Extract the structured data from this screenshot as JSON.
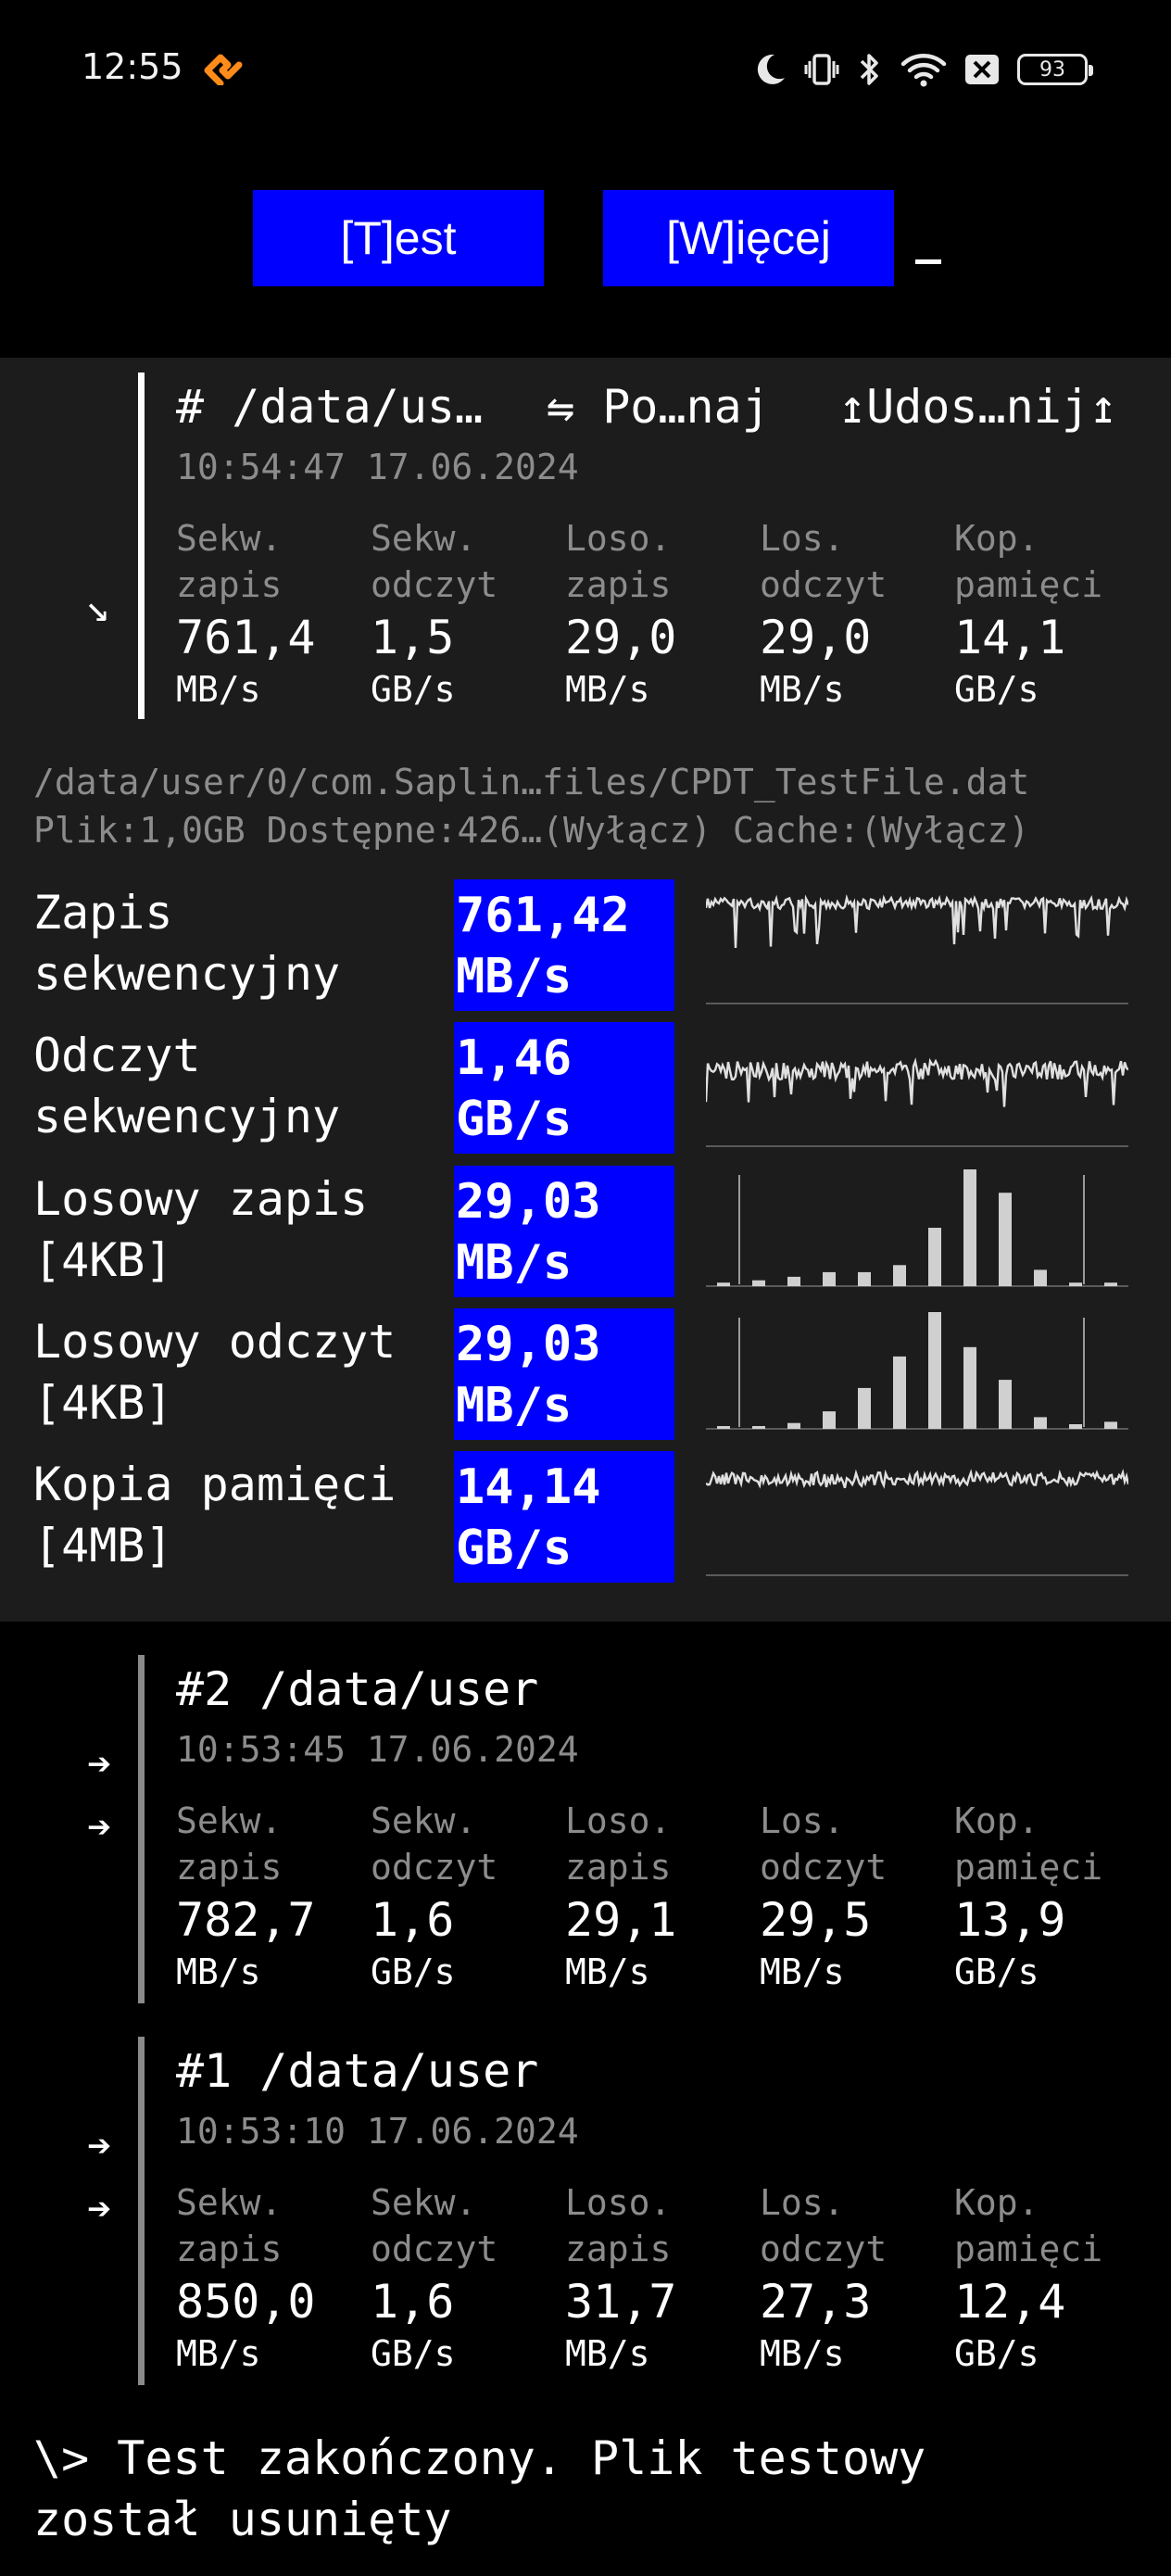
{
  "status_bar": {
    "time": "12:55",
    "battery": "93"
  },
  "toolbar": {
    "test_label": "[T]est",
    "more_label": "[W]ięcej",
    "cursor": "_"
  },
  "current": {
    "title": "#  /data/us…",
    "compare_label": "⇋ Po…naj",
    "share_label": "↥Udos…nij↥",
    "date": "10:54:47 17.06.2024",
    "arrow": "↘",
    "metrics": [
      {
        "label1": "Sekw.",
        "label2": "zapis",
        "value": "761,4",
        "unit": "MB/s"
      },
      {
        "label1": "Sekw.",
        "label2": "odczyt",
        "value": "1,5",
        "unit": "GB/s"
      },
      {
        "label1": "Loso.",
        "label2": "zapis",
        "value": "29,0",
        "unit": "MB/s"
      },
      {
        "label1": "Los.",
        "label2": "odczyt",
        "value": "29,0",
        "unit": "MB/s"
      },
      {
        "label1": "Kop.",
        "label2": "pamięci",
        "value": "14,1",
        "unit": "GB/s"
      }
    ],
    "file_path": "/data/user/0/com.Saplin…files/CPDT_TestFile.dat",
    "file_info": "Plik:1,0GB Dostępne:426…(Wyłącz) Cache:(Wyłącz)",
    "rows": [
      {
        "label1": "Zapis",
        "label2": "sekwencyjny",
        "value1": "761,42",
        "value2": "MB/s",
        "graph": "noise-seq-write"
      },
      {
        "label1": "Odczyt",
        "label2": "sekwencyjny",
        "value1": "1,46",
        "value2": "GB/s",
        "graph": "noise-seq-read"
      },
      {
        "label1": "Losowy zapis",
        "label2": "[4KB]",
        "value1": "29,03",
        "value2": "MB/s",
        "graph": "histogram",
        "bars": [
          0.03,
          0.05,
          0.08,
          0.12,
          0.12,
          0.18,
          0.5,
          1.0,
          0.8,
          0.14,
          0.03,
          0.03
        ]
      },
      {
        "label1": "Losowy odczyt",
        "label2": "[4KB]",
        "value1": "29,03",
        "value2": "MB/s",
        "graph": "histogram",
        "bars": [
          0.02,
          0.02,
          0.05,
          0.15,
          0.35,
          0.62,
          1.0,
          0.7,
          0.42,
          0.1,
          0.04,
          0.06
        ]
      },
      {
        "label1": "Kopia pamięci",
        "label2": "[4MB]",
        "value1": "14,14",
        "value2": "GB/s",
        "graph": "noise-mem"
      }
    ]
  },
  "history": [
    {
      "title": "#2 /data/user",
      "date": "10:53:45 17.06.2024",
      "arrows": [
        "➔",
        "➔"
      ],
      "metrics": [
        {
          "label1": "Sekw.",
          "label2": "zapis",
          "value": "782,7",
          "unit": "MB/s"
        },
        {
          "label1": "Sekw.",
          "label2": "odczyt",
          "value": "1,6",
          "unit": "GB/s"
        },
        {
          "label1": "Loso.",
          "label2": "zapis",
          "value": "29,1",
          "unit": "MB/s"
        },
        {
          "label1": "Los.",
          "label2": "odczyt",
          "value": "29,5",
          "unit": "MB/s"
        },
        {
          "label1": "Kop.",
          "label2": "pamięci",
          "value": "13,9",
          "unit": "GB/s"
        }
      ]
    },
    {
      "title": "#1 /data/user",
      "date": "10:53:10 17.06.2024",
      "arrows": [
        "➔",
        "➔"
      ],
      "metrics": [
        {
          "label1": "Sekw.",
          "label2": "zapis",
          "value": "850,0",
          "unit": "MB/s"
        },
        {
          "label1": "Sekw.",
          "label2": "odczyt",
          "value": "1,6",
          "unit": "GB/s"
        },
        {
          "label1": "Loso.",
          "label2": "zapis",
          "value": "31,7",
          "unit": "MB/s"
        },
        {
          "label1": "Los.",
          "label2": "odczyt",
          "value": "27,3",
          "unit": "MB/s"
        },
        {
          "label1": "Kop.",
          "label2": "pamięci",
          "value": "12,4",
          "unit": "GB/s"
        }
      ]
    }
  ],
  "message": {
    "line1": "\\> Test zakończony. Plik testowy",
    "line2": "został usunięty"
  }
}
